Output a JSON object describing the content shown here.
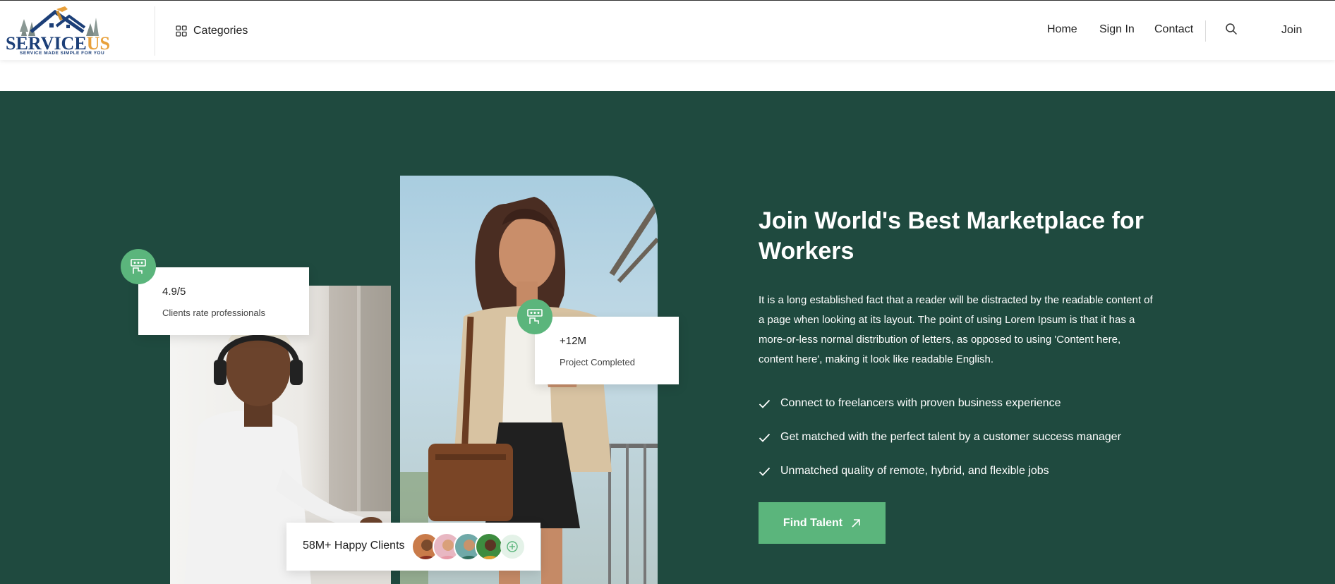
{
  "header": {
    "logo": {
      "text_main": "SERVICE",
      "text_accent": "US",
      "tagline": "SERVICE MADE SIMPLE FOR YOU"
    },
    "categories_label": "Categories",
    "nav": [
      {
        "label": "Home"
      },
      {
        "label": "Sign In"
      },
      {
        "label": "Contact"
      }
    ],
    "join_label": "Join"
  },
  "hero": {
    "title": "Join World's Best Marketplace for Workers",
    "description": "It is a long established fact that a reader will be distracted by the readable content of a page when looking at its layout. The point of using Lorem Ipsum is that it has a more-or-less normal distribution of letters, as opposed to using 'Content here, content here', making it look like readable English.",
    "features": [
      {
        "text": "Connect to freelancers with proven business experience"
      },
      {
        "text": "Get matched with the perfect talent by a customer success manager"
      },
      {
        "text": "Unmatched quality of remote, hybrid, and flexible jobs"
      }
    ],
    "cta_label": "Find Talent",
    "stats": {
      "rating_value": "4.9/5",
      "rating_label": "Clients rate professionals",
      "projects_value": "+12M",
      "projects_label": "Project Completed"
    },
    "clients_label": "58M+ Happy Clients"
  },
  "colors": {
    "hero_bg": "#1f4a3f",
    "accent_green": "#5bb57c",
    "logo_blue": "#1c3f78",
    "logo_orange": "#e8a03a"
  },
  "icons": {
    "categories": "grid-icon",
    "search": "search-icon",
    "badge": "worker-icon",
    "feature": "check-icon",
    "cta": "arrow-up-right-icon",
    "more_clients": "plus-circle-icon"
  }
}
